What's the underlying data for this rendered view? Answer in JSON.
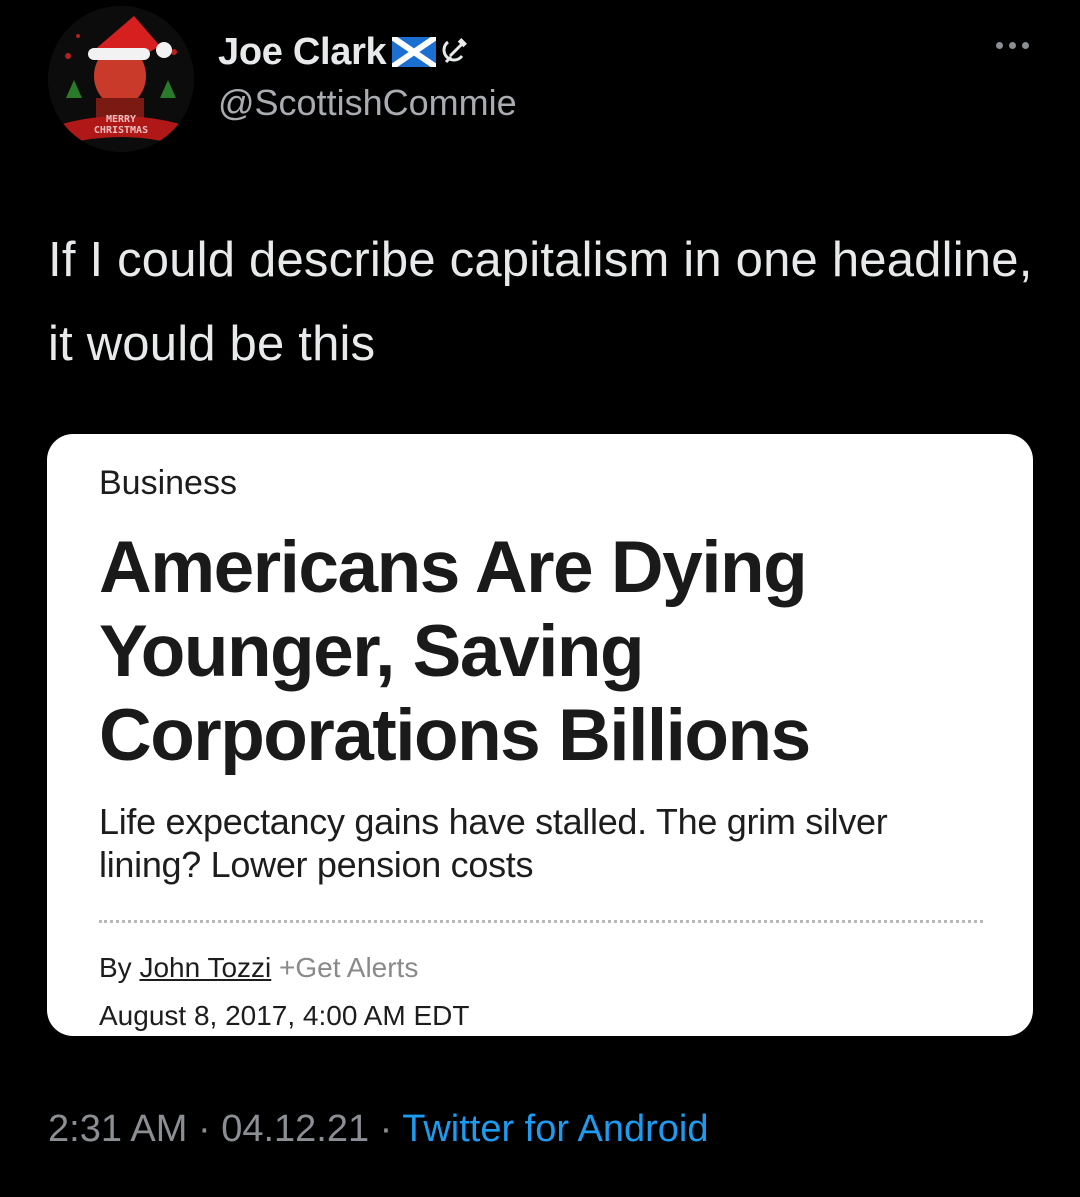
{
  "author": {
    "display_name": "Joe Clark",
    "handle": "@ScottishCommie",
    "avatar_text_line1": "MERRY",
    "avatar_text_line2": "CHRISTMAS",
    "badges": [
      "scottish-flag-icon",
      "hammer-and-sickle-icon"
    ]
  },
  "tweet": {
    "text": "If I could describe capitalism in one headline, it would be this"
  },
  "media_card": {
    "section": "Business",
    "headline": "Americans Are Dying Younger, Saving Corporations Billions",
    "dek": "Life expectancy gains have stalled. The grim silver lining? Lower pension costs",
    "byline_prefix": "By ",
    "author": "John Tozzi",
    "alerts": "+Get Alerts",
    "date": "August 8, 2017, 4:00 AM EDT"
  },
  "meta": {
    "time": "2:31 AM",
    "separator": " · ",
    "date": "04.12.21",
    "source": "Twitter for Android"
  },
  "colors": {
    "background": "#000000",
    "text_primary": "#e7e9ea",
    "text_secondary": "#8b8f93",
    "link": "#1d9bf0",
    "card_background": "#ffffff"
  }
}
